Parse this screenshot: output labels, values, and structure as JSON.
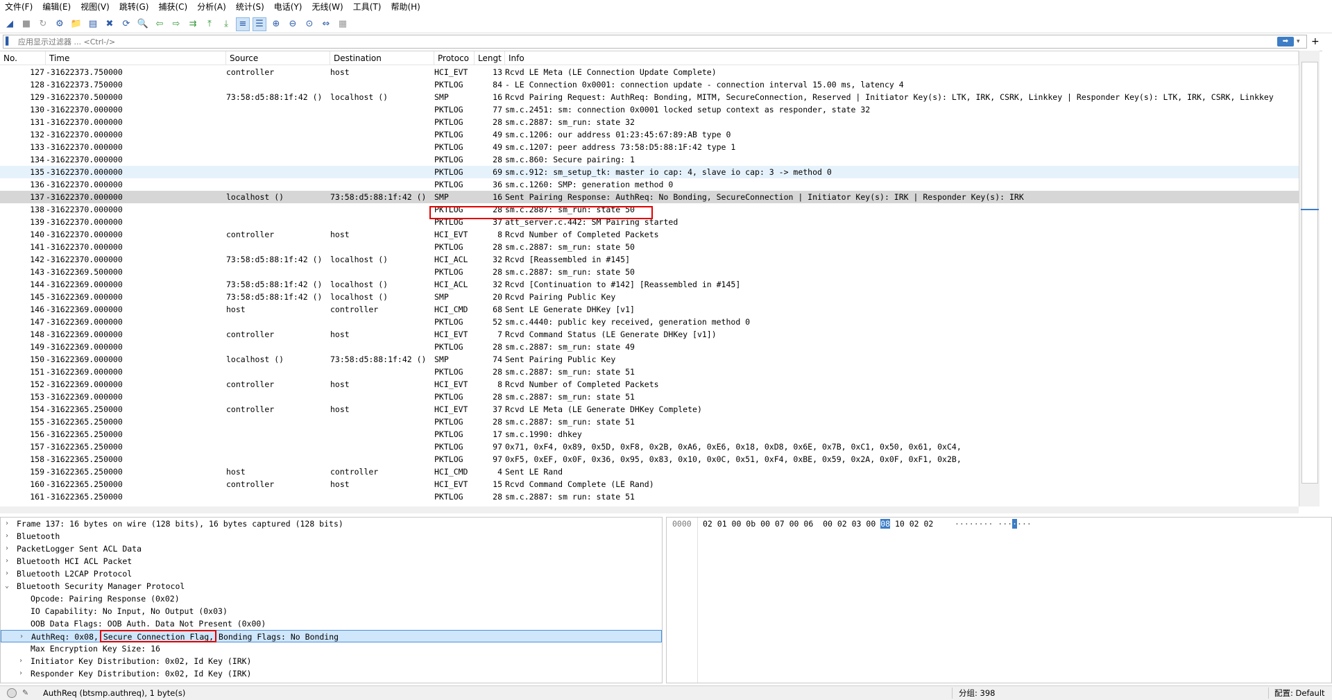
{
  "menu": [
    "文件(F)",
    "编辑(E)",
    "视图(V)",
    "跳转(G)",
    "捕获(C)",
    "分析(A)",
    "统计(S)",
    "电话(Y)",
    "无线(W)",
    "工具(T)",
    "帮助(H)"
  ],
  "filter": {
    "placeholder": "应用显示过滤器 ... <Ctrl-/>",
    "apply_icon": "arrow-right-icon",
    "add_label": "+"
  },
  "columns": {
    "no": "No.",
    "time": "Time",
    "source": "Source",
    "destination": "Destination",
    "protocol": "Protoco",
    "length": "Lengt",
    "info": "Info"
  },
  "packets": [
    {
      "no": "127",
      "time": "-31622373.750000",
      "src": "controller",
      "dst": "host",
      "proto": "HCI_EVT",
      "len": "13",
      "info": "Rcvd LE Meta (LE Connection Update Complete)"
    },
    {
      "no": "128",
      "time": "-31622373.750000",
      "src": "",
      "dst": "",
      "proto": "PKTLOG",
      "len": "84",
      "info": "- LE Connection 0x0001: connection update - connection interval 15.00 ms, latency 4"
    },
    {
      "no": "129",
      "time": "-31622370.500000",
      "src": "73:58:d5:88:1f:42 ()",
      "dst": "localhost ()",
      "proto": "SMP",
      "len": "16",
      "info": "Rcvd Pairing Request: AuthReq: Bonding, MITM, SecureConnection, Reserved | Initiator Key(s): LTK, IRK, CSRK, Linkkey | Responder Key(s): LTK, IRK, CSRK, Linkkey"
    },
    {
      "no": "130",
      "time": "-31622370.000000",
      "src": "",
      "dst": "",
      "proto": "PKTLOG",
      "len": "77",
      "info": "sm.c.2451: sm: connection 0x0001 locked setup context as responder, state 32"
    },
    {
      "no": "131",
      "time": "-31622370.000000",
      "src": "",
      "dst": "",
      "proto": "PKTLOG",
      "len": "28",
      "info": "sm.c.2887: sm_run: state 32"
    },
    {
      "no": "132",
      "time": "-31622370.000000",
      "src": "",
      "dst": "",
      "proto": "PKTLOG",
      "len": "49",
      "info": "sm.c.1206: our  address 01:23:45:67:89:AB type 0"
    },
    {
      "no": "133",
      "time": "-31622370.000000",
      "src": "",
      "dst": "",
      "proto": "PKTLOG",
      "len": "49",
      "info": "sm.c.1207: peer address 73:58:D5:88:1F:42 type 1"
    },
    {
      "no": "134",
      "time": "-31622370.000000",
      "src": "",
      "dst": "",
      "proto": "PKTLOG",
      "len": "28",
      "info": "sm.c.860: Secure pairing: 1"
    },
    {
      "no": "135",
      "time": "-31622370.000000",
      "src": "",
      "dst": "",
      "proto": "PKTLOG",
      "len": "69",
      "info": "sm.c.912: sm_setup_tk: master io cap: 4, slave io cap: 3 -> method 0"
    },
    {
      "no": "136",
      "time": "-31622370.000000",
      "src": "",
      "dst": "",
      "proto": "PKTLOG",
      "len": "36",
      "info": "sm.c.1260: SMP: generation method 0"
    },
    {
      "no": "137",
      "time": "-31622370.000000",
      "src": "localhost ()",
      "dst": "73:58:d5:88:1f:42 ()",
      "proto": "SMP",
      "len": "16",
      "info": "Sent Pairing Response: AuthReq: No Bonding, SecureConnection | Initiator Key(s): IRK | Responder Key(s): IRK"
    },
    {
      "no": "138",
      "time": "-31622370.000000",
      "src": "",
      "dst": "",
      "proto": "PKTLOG",
      "len": "28",
      "info": "sm.c.2887: sm_run: state 50"
    },
    {
      "no": "139",
      "time": "-31622370.000000",
      "src": "",
      "dst": "",
      "proto": "PKTLOG",
      "len": "37",
      "info": "att_server.c.442: SM Pairing started"
    },
    {
      "no": "140",
      "time": "-31622370.000000",
      "src": "controller",
      "dst": "host",
      "proto": "HCI_EVT",
      "len": "8",
      "info": "Rcvd Number of Completed Packets"
    },
    {
      "no": "141",
      "time": "-31622370.000000",
      "src": "",
      "dst": "",
      "proto": "PKTLOG",
      "len": "28",
      "info": "sm.c.2887: sm_run: state 50"
    },
    {
      "no": "142",
      "time": "-31622370.000000",
      "src": "73:58:d5:88:1f:42 ()",
      "dst": "localhost ()",
      "proto": "HCI_ACL",
      "len": "32",
      "info": "Rcvd  [Reassembled in #145]"
    },
    {
      "no": "143",
      "time": "-31622369.500000",
      "src": "",
      "dst": "",
      "proto": "PKTLOG",
      "len": "28",
      "info": "sm.c.2887: sm_run: state 50"
    },
    {
      "no": "144",
      "time": "-31622369.000000",
      "src": "73:58:d5:88:1f:42 ()",
      "dst": "localhost ()",
      "proto": "HCI_ACL",
      "len": "32",
      "info": "Rcvd  [Continuation to #142] [Reassembled in #145]"
    },
    {
      "no": "145",
      "time": "-31622369.000000",
      "src": "73:58:d5:88:1f:42 ()",
      "dst": "localhost ()",
      "proto": "SMP",
      "len": "20",
      "info": "Rcvd Pairing Public Key"
    },
    {
      "no": "146",
      "time": "-31622369.000000",
      "src": "host",
      "dst": "controller",
      "proto": "HCI_CMD",
      "len": "68",
      "info": "Sent LE Generate DHKey [v1]"
    },
    {
      "no": "147",
      "time": "-31622369.000000",
      "src": "",
      "dst": "",
      "proto": "PKTLOG",
      "len": "52",
      "info": "sm.c.4440: public key received, generation method 0"
    },
    {
      "no": "148",
      "time": "-31622369.000000",
      "src": "controller",
      "dst": "host",
      "proto": "HCI_EVT",
      "len": "7",
      "info": "Rcvd Command Status (LE Generate DHKey [v1])"
    },
    {
      "no": "149",
      "time": "-31622369.000000",
      "src": "",
      "dst": "",
      "proto": "PKTLOG",
      "len": "28",
      "info": "sm.c.2887: sm_run: state 49"
    },
    {
      "no": "150",
      "time": "-31622369.000000",
      "src": "localhost ()",
      "dst": "73:58:d5:88:1f:42 ()",
      "proto": "SMP",
      "len": "74",
      "info": "Sent Pairing Public Key"
    },
    {
      "no": "151",
      "time": "-31622369.000000",
      "src": "",
      "dst": "",
      "proto": "PKTLOG",
      "len": "28",
      "info": "sm.c.2887: sm_run: state 51"
    },
    {
      "no": "152",
      "time": "-31622369.000000",
      "src": "controller",
      "dst": "host",
      "proto": "HCI_EVT",
      "len": "8",
      "info": "Rcvd Number of Completed Packets"
    },
    {
      "no": "153",
      "time": "-31622369.000000",
      "src": "",
      "dst": "",
      "proto": "PKTLOG",
      "len": "28",
      "info": "sm.c.2887: sm_run: state 51"
    },
    {
      "no": "154",
      "time": "-31622365.250000",
      "src": "controller",
      "dst": "host",
      "proto": "HCI_EVT",
      "len": "37",
      "info": "Rcvd LE Meta (LE Generate DHKey Complete)"
    },
    {
      "no": "155",
      "time": "-31622365.250000",
      "src": "",
      "dst": "",
      "proto": "PKTLOG",
      "len": "28",
      "info": "sm.c.2887: sm_run: state 51"
    },
    {
      "no": "156",
      "time": "-31622365.250000",
      "src": "",
      "dst": "",
      "proto": "PKTLOG",
      "len": "17",
      "info": "sm.c.1990: dhkey"
    },
    {
      "no": "157",
      "time": "-31622365.250000",
      "src": "",
      "dst": "",
      "proto": "PKTLOG",
      "len": "97",
      "info": "0x71, 0xF4, 0x89, 0x5D, 0xF8, 0x2B, 0xA6, 0xE6, 0x18, 0xD8, 0x6E, 0x7B, 0xC1, 0x50, 0x61, 0xC4,"
    },
    {
      "no": "158",
      "time": "-31622365.250000",
      "src": "",
      "dst": "",
      "proto": "PKTLOG",
      "len": "97",
      "info": "0xF5, 0xEF, 0x0F, 0x36, 0x95, 0x83, 0x10, 0x0C, 0x51, 0xF4, 0xBE, 0x59, 0x2A, 0x0F, 0xF1, 0x2B,"
    },
    {
      "no": "159",
      "time": "-31622365.250000",
      "src": "host",
      "dst": "controller",
      "proto": "HCI_CMD",
      "len": "4",
      "info": "Sent LE Rand"
    },
    {
      "no": "160",
      "time": "-31622365.250000",
      "src": "controller",
      "dst": "host",
      "proto": "HCI_EVT",
      "len": "15",
      "info": "Rcvd Command Complete (LE Rand)"
    },
    {
      "no": "161",
      "time": "-31622365.250000",
      "src": "",
      "dst": "",
      "proto": "PKTLOG",
      "len": "28",
      "info": "sm.c.2887: sm run: state 51"
    }
  ],
  "details": [
    {
      "level": 0,
      "expander": "›",
      "text": "Frame 137: 16 bytes on wire (128 bits), 16 bytes captured (128 bits)"
    },
    {
      "level": 0,
      "expander": "›",
      "text": "Bluetooth"
    },
    {
      "level": 0,
      "expander": "›",
      "text": "PacketLogger Sent ACL Data"
    },
    {
      "level": 0,
      "expander": "›",
      "text": "Bluetooth HCI ACL Packet"
    },
    {
      "level": 0,
      "expander": "›",
      "text": "Bluetooth L2CAP Protocol"
    },
    {
      "level": 0,
      "expander": "⌄",
      "text": "Bluetooth Security Manager Protocol"
    },
    {
      "level": 1,
      "expander": "",
      "text": "Opcode: Pairing Response (0x02)"
    },
    {
      "level": 1,
      "expander": "",
      "text": "IO Capability: No Input, No Output (0x03)"
    },
    {
      "level": 1,
      "expander": "",
      "text": "OOB Data Flags: OOB Auth. Data Not Present (0x00)"
    },
    {
      "level": 1,
      "expander": "›",
      "text": "AuthReq: 0x08, Secure Connection Flag, Bonding Flags: No Bonding"
    },
    {
      "level": 1,
      "expander": "",
      "text": "Max Encryption Key Size: 16"
    },
    {
      "level": 1,
      "expander": "›",
      "text": "Initiator Key Distribution: 0x02, Id Key (IRK)"
    },
    {
      "level": 1,
      "expander": "›",
      "text": "Responder Key Distribution: 0x02, Id Key (IRK)"
    }
  ],
  "bytes": {
    "offset": "0000",
    "hex_before": "02 01 00 0b 00 07 00 06  00 02 03 00 ",
    "hex_selected": "08",
    "hex_after": " 10 02 02",
    "ascii_before": "········ ···",
    "ascii_selected": "·",
    "ascii_after": "···"
  },
  "status": {
    "field": "AuthReq (btsmp.authreq), 1 byte(s)",
    "packets": "分组: 398",
    "profile": "配置: Default"
  },
  "highlights": {
    "selected_row_color": "#d6d6d6",
    "light_row_color": "#e6f2fb",
    "annotation_color": "#e00000",
    "selection_color": "#3c7dc5"
  }
}
